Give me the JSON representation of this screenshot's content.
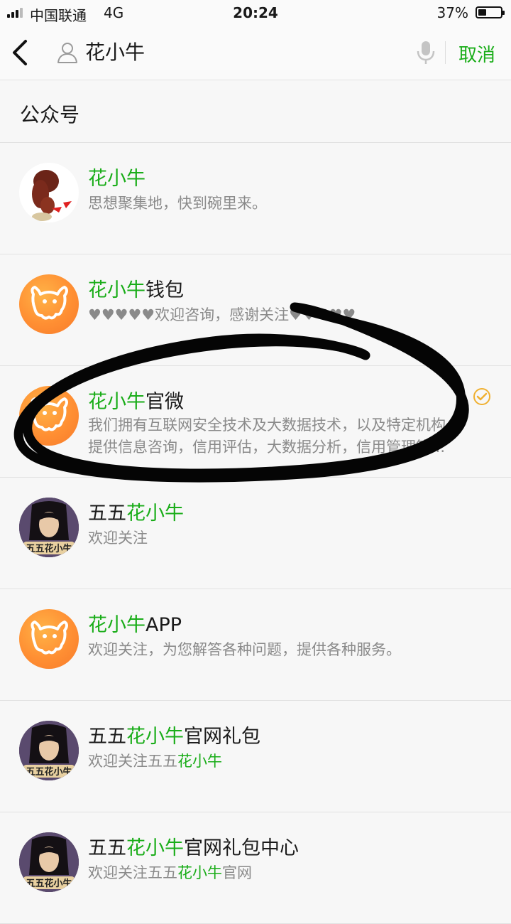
{
  "status_bar": {
    "carrier": "中国联通",
    "network": "4G",
    "time": "20:24",
    "battery_percent": "37%",
    "battery_level": 0.37
  },
  "search": {
    "query": "花小牛",
    "cancel_label": "取消",
    "icons": [
      "back-chevron-icon",
      "person-icon",
      "microphone-icon"
    ]
  },
  "section": {
    "title": "公众号"
  },
  "results": [
    {
      "title_highlight": "花小牛",
      "title_rest": "",
      "description": "思想聚集地，快到碗里来。",
      "avatar": "girl-hair-flower-avatar"
    },
    {
      "title_highlight": "花小牛",
      "title_rest": "钱包",
      "description": "♥♥♥♥♥欢迎咨询，感谢关注♥♥♥♥♥",
      "avatar": "orange-cow-avatar"
    },
    {
      "title_highlight": "花小牛",
      "title_rest": "官微",
      "description_line1": "我们拥有互联网安全技术及大数据技术，以及特定机构",
      "description_line2": "提供信息咨询，信用评估，大数据分析，信用管理等...",
      "avatar": "orange-cow-avatar",
      "verified": true
    },
    {
      "title_prefix": "五五",
      "title_highlight": "花小牛",
      "title_rest": "",
      "description": "欢迎关注",
      "avatar": "game-hero-avatar"
    },
    {
      "title_highlight": "花小牛",
      "title_rest": "APP",
      "description": "欢迎关注，为您解答各种问题，提供各种服务。",
      "avatar": "orange-cow-avatar"
    },
    {
      "title_prefix": "五五",
      "title_highlight": "花小牛",
      "title_rest": "官网礼包",
      "desc_prefix": "欢迎关注五五",
      "desc_highlight": "花小牛",
      "desc_rest": "",
      "avatar": "game-hero-avatar"
    },
    {
      "title_prefix": "五五",
      "title_highlight": "花小牛",
      "title_rest": "官网礼包中心",
      "desc_prefix": "欢迎关注五五",
      "desc_highlight": "花小牛",
      "desc_rest": "官网",
      "avatar": "game-hero-avatar"
    }
  ],
  "colors": {
    "accent_green": "#1aad19",
    "secondary_text": "#8a8a8a",
    "cow_orange": "#ff8f33"
  }
}
